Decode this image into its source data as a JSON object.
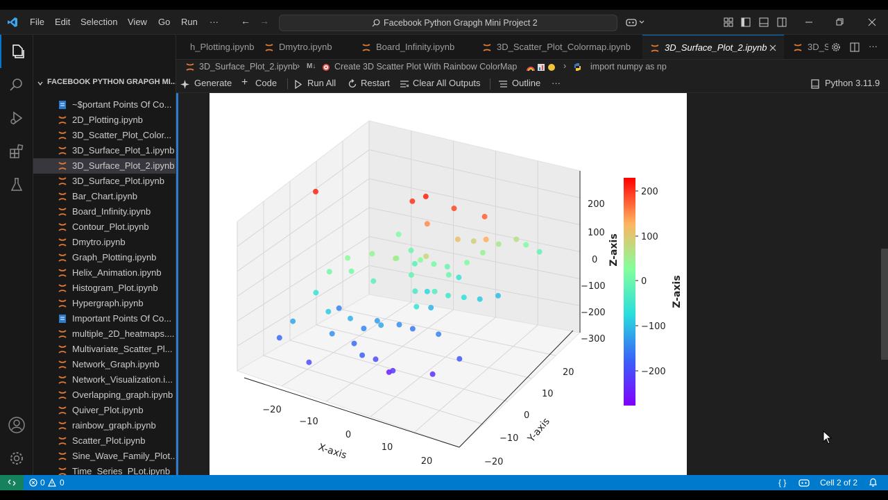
{
  "titlebar": {
    "menus": [
      "File",
      "Edit",
      "Selection",
      "View",
      "Go",
      "Run",
      "···"
    ],
    "search": "Facebook Python Grapgh Mini Project 2"
  },
  "sidebar": {
    "title": "FACEBOOK PYTHON GRAPGH MI...",
    "files": [
      {
        "name": "~$portant Points Of Co...",
        "kind": "doc"
      },
      {
        "name": "2D_Plotting.ipynb",
        "kind": "nb"
      },
      {
        "name": "3D_Scatter_Plot_Color...",
        "kind": "nb"
      },
      {
        "name": "3D_Surface_Plot_1.ipynb",
        "kind": "nb"
      },
      {
        "name": "3D_Surface_Plot_2.ipynb",
        "kind": "nb",
        "selected": true
      },
      {
        "name": "3D_Surface_Plot.ipynb",
        "kind": "nb"
      },
      {
        "name": "Bar_Chart.ipynb",
        "kind": "nb"
      },
      {
        "name": "Board_Infinity.ipynb",
        "kind": "nb"
      },
      {
        "name": "Contour_Plot.ipynb",
        "kind": "nb"
      },
      {
        "name": "Dmytro.ipynb",
        "kind": "nb"
      },
      {
        "name": "Graph_Plotting.ipynb",
        "kind": "nb"
      },
      {
        "name": "Helix_Animation.ipynb",
        "kind": "nb"
      },
      {
        "name": "Histogram_Plot.ipynb",
        "kind": "nb"
      },
      {
        "name": "Hypergraph.ipynb",
        "kind": "nb"
      },
      {
        "name": "Important Points Of Co...",
        "kind": "doc"
      },
      {
        "name": "multiple_2D_heatmaps....",
        "kind": "nb"
      },
      {
        "name": "Multivariate_Scatter_Pl...",
        "kind": "nb"
      },
      {
        "name": "Network_Graph.ipynb",
        "kind": "nb"
      },
      {
        "name": "Network_Visualization.i...",
        "kind": "nb"
      },
      {
        "name": "Overlapping_graph.ipynb",
        "kind": "nb"
      },
      {
        "name": "Quiver_Plot.ipynb",
        "kind": "nb"
      },
      {
        "name": "rainbow_graph.ipynb",
        "kind": "nb"
      },
      {
        "name": "Scatter_Plot.ipynb",
        "kind": "nb"
      },
      {
        "name": "Sine_Wave_Family_Plot....",
        "kind": "nb"
      },
      {
        "name": "Time_Series_PLot.ipynb",
        "kind": "nb"
      }
    ]
  },
  "tabs": [
    {
      "label": "h_Plotting.ipynb",
      "active": false
    },
    {
      "label": "Dmytro.ipynb",
      "active": false
    },
    {
      "label": "Board_Infinity.ipynb",
      "active": false
    },
    {
      "label": "3D_Scatter_Plot_Colormap.ipynb",
      "active": false
    },
    {
      "label": "3D_Surface_Plot_2.ipynb",
      "active": true
    },
    {
      "label": "3D_S",
      "active": false
    }
  ],
  "breadcrumb": {
    "file": "3D_Surface_Plot_2.ipynb",
    "md_badge": "M↓",
    "cell": "Create 3D Scatter Plot With Rainbow ColorMap",
    "code": "import numpy as np"
  },
  "notebook_toolbar": {
    "generate": "Generate",
    "code": "Code",
    "run_all": "Run All",
    "restart": "Restart",
    "clear": "Clear All Outputs",
    "outline": "Outline",
    "more": "···",
    "kernel": "Python 3.11.9"
  },
  "statusbar": {
    "errors": "0",
    "warnings": "0",
    "cell": "Cell 2 of 2",
    "braces": "{ }"
  },
  "colors": {
    "accent": "#0078d4",
    "statusbar": "#007acc",
    "notebook_icon": "#e37933",
    "doc_icon": "#2b7bd1"
  },
  "chart_data": {
    "type": "scatter",
    "projection": "3d",
    "colormap": "rainbow",
    "xlabel": "X-axis",
    "ylabel": "Y-axis",
    "zlabel": "Z-axis",
    "colorbar_label": "Z-axis",
    "x_ticks": [
      "−20",
      "−10",
      "0",
      "10",
      "20"
    ],
    "y_ticks": [
      "−20",
      "−10",
      "0",
      "10",
      "20"
    ],
    "z_ticks": [
      "200",
      "100",
      "0",
      "−100",
      "−200",
      "−300"
    ],
    "colorbar_ticks": [
      "200",
      "100",
      "0",
      "−100",
      "−200"
    ],
    "xlim": [
      -25,
      25
    ],
    "ylim": [
      -25,
      25
    ],
    "zlim": [
      -300,
      250
    ],
    "clim": [
      -280,
      230
    ],
    "grid": true,
    "points": [
      {
        "x": 2,
        "y": 5,
        "z": 210
      },
      {
        "x": 0,
        "y": 3,
        "z": 200
      },
      {
        "x": 8,
        "y": 6,
        "z": 190
      },
      {
        "x": 14,
        "y": 8,
        "z": 175
      },
      {
        "x": 16,
        "y": 5,
        "z": 130
      },
      {
        "x": 10,
        "y": 4,
        "z": 110
      },
      {
        "x": 12,
        "y": 7,
        "z": 90
      },
      {
        "x": 4,
        "y": 2,
        "z": 150
      },
      {
        "x": 6,
        "y": -2,
        "z": 80
      },
      {
        "x": -18,
        "y": -5,
        "z": 210
      },
      {
        "x": -6,
        "y": -3,
        "z": 40
      },
      {
        "x": -2,
        "y": 0,
        "z": 20
      },
      {
        "x": 0,
        "y": -4,
        "z": 60
      },
      {
        "x": 3,
        "y": 1,
        "z": 30
      },
      {
        "x": 5,
        "y": 3,
        "z": 10
      },
      {
        "x": 7,
        "y": 5,
        "z": -5
      },
      {
        "x": 9,
        "y": 2,
        "z": 0
      },
      {
        "x": 11,
        "y": 6,
        "z": 20
      },
      {
        "x": 13,
        "y": 9,
        "z": 40
      },
      {
        "x": 15,
        "y": 12,
        "z": 55
      },
      {
        "x": 18,
        "y": 14,
        "z": 70
      },
      {
        "x": -10,
        "y": -6,
        "z": 30
      },
      {
        "x": -8,
        "y": -8,
        "z": 10
      },
      {
        "x": -4,
        "y": -6,
        "z": -20
      },
      {
        "x": -12,
        "y": -10,
        "z": 5
      },
      {
        "x": 2,
        "y": -1,
        "z": -10
      },
      {
        "x": 4,
        "y": -3,
        "z": -40
      },
      {
        "x": 6,
        "y": -6,
        "z": -60
      },
      {
        "x": 8,
        "y": -2,
        "z": -30
      },
      {
        "x": 10,
        "y": 0,
        "z": -50
      },
      {
        "x": 12,
        "y": 3,
        "z": -70
      },
      {
        "x": 14,
        "y": 6,
        "z": -90
      },
      {
        "x": 16,
        "y": 10,
        "z": -100
      },
      {
        "x": 0,
        "y": 4,
        "z": -20
      },
      {
        "x": -2,
        "y": 6,
        "z": 0
      },
      {
        "x": -6,
        "y": 8,
        "z": 20
      },
      {
        "x": 18,
        "y": 18,
        "z": 20
      },
      {
        "x": 20,
        "y": 20,
        "z": -10
      },
      {
        "x": -14,
        "y": -12,
        "z": -60
      },
      {
        "x": -10,
        "y": -14,
        "z": -90
      },
      {
        "x": -16,
        "y": -18,
        "z": -120
      },
      {
        "x": -6,
        "y": -12,
        "z": -110
      },
      {
        "x": -4,
        "y": -10,
        "z": -150
      },
      {
        "x": -2,
        "y": -8,
        "z": -130
      },
      {
        "x": 0,
        "y": -10,
        "z": -120
      },
      {
        "x": 2,
        "y": -6,
        "z": -140
      },
      {
        "x": 4,
        "y": -4,
        "z": -160
      },
      {
        "x": 6,
        "y": 0,
        "z": -110
      },
      {
        "x": -8,
        "y": -16,
        "z": -140
      },
      {
        "x": -4,
        "y": -14,
        "z": -170
      },
      {
        "x": -1,
        "y": -16,
        "z": -180
      },
      {
        "x": 1,
        "y": -14,
        "z": -200
      },
      {
        "x": 3,
        "y": -12,
        "z": -250
      },
      {
        "x": 5,
        "y": -14,
        "z": -220
      },
      {
        "x": 12,
        "y": -10,
        "z": -230
      },
      {
        "x": 16,
        "y": -6,
        "z": -190
      },
      {
        "x": -18,
        "y": -20,
        "z": -170
      },
      {
        "x": -10,
        "y": -22,
        "z": -200
      },
      {
        "x": -12,
        "y": -6,
        "z": -150
      },
      {
        "x": 10,
        "y": -4,
        "z": -150
      },
      {
        "x": 4,
        "y": 2,
        "z": -80
      },
      {
        "x": 8,
        "y": 8,
        "z": -60
      }
    ]
  }
}
